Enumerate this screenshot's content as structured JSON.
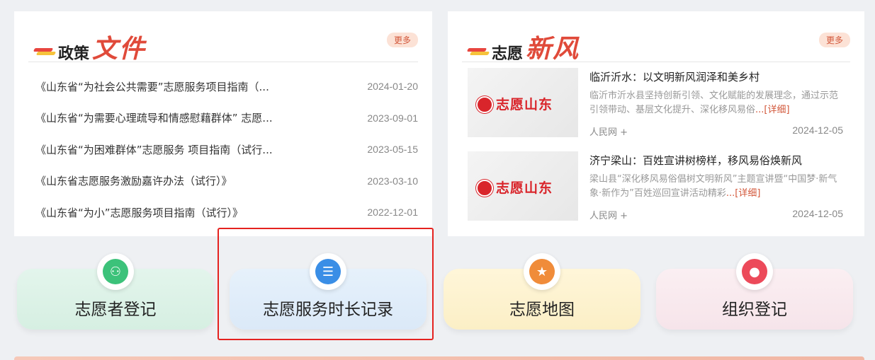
{
  "policy": {
    "title_a": "政策",
    "title_b": "文件",
    "more": "更多",
    "items": [
      {
        "title": "《山东省“为社会公共需要”志愿服务项目指南（...",
        "date": "2024-01-20"
      },
      {
        "title": "《山东省“为需要心理疏导和情感慰藉群体” 志愿...",
        "date": "2023-09-01"
      },
      {
        "title": "《山东省“为困难群体”志愿服务 项目指南（试行...",
        "date": "2023-05-15"
      },
      {
        "title": "《山东省志愿服务激励嘉许办法（试行）》",
        "date": "2023-03-10"
      },
      {
        "title": "《山东省“为小”志愿服务项目指南（试行）》",
        "date": "2022-12-01"
      }
    ]
  },
  "news": {
    "title_a": "志愿",
    "title_b": "新风",
    "more": "更多",
    "items": [
      {
        "image_text": "志愿山东",
        "title": "临沂沂水：以文明新风润泽和美乡村",
        "desc": "临沂市沂水县坚持创新引领、文化赋能的发展理念，通过示范引领带动、基层文化提升、深化移风易俗",
        "detail": "...[详细]",
        "source": "人民网 +",
        "date": "2024-12-05"
      },
      {
        "image_text": "志愿山东",
        "title": "济宁梁山：百姓宣讲树榜样，移风易俗焕新风",
        "desc": "梁山县“深化移风易俗倡树文明新风”主题宣讲暨“中国梦·新气象·新作为”百姓巡回宣讲活动精彩",
        "detail": "...[详细]",
        "source": "人民网 +",
        "date": "2024-12-05"
      }
    ]
  },
  "cards": [
    {
      "label": "志愿者登记",
      "icon": "volunteer-register-icon",
      "color": "#3cc27a"
    },
    {
      "label": "志愿服务时长记录",
      "icon": "service-hours-icon",
      "color": "#3a8ee6"
    },
    {
      "label": "志愿地图",
      "icon": "map-icon",
      "color": "#f08c3a"
    },
    {
      "label": "组织登记",
      "icon": "organization-icon",
      "color": "#ec4a5a"
    }
  ]
}
